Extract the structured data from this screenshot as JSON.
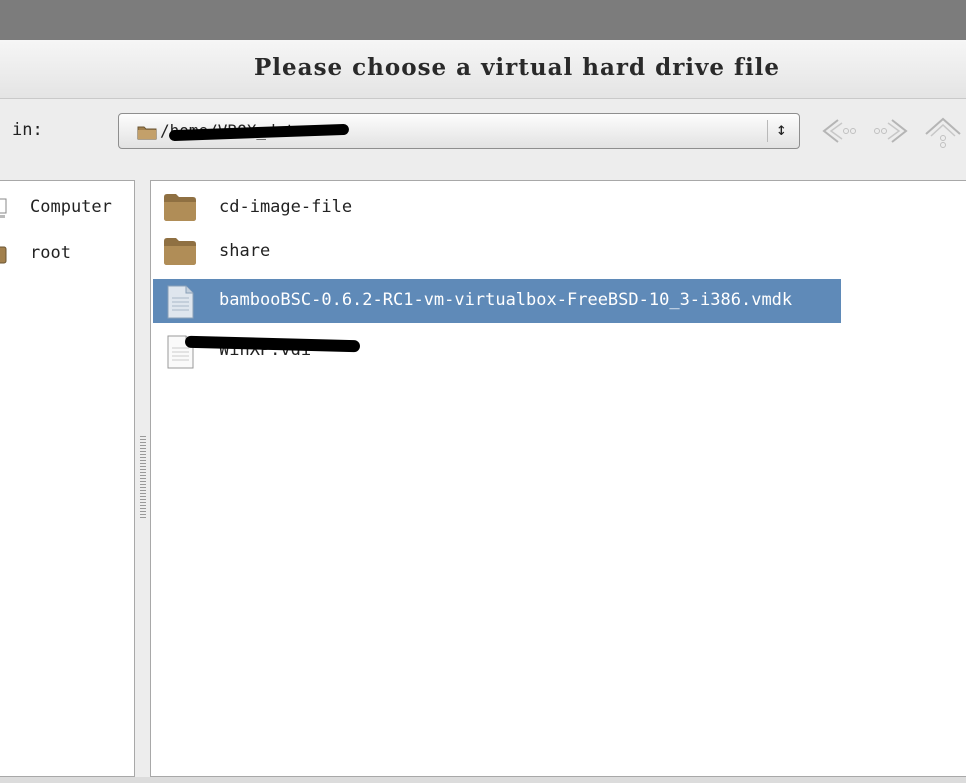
{
  "dialog": {
    "title": "Please choose a virtual hard drive file"
  },
  "toolbar": {
    "look_in_label": "in:",
    "path_value": "/home/VBOX_dat",
    "combo_arrow": "↕"
  },
  "sidebar": {
    "items": [
      {
        "label": "Computer",
        "icon": "computer-icon"
      },
      {
        "label": "root",
        "icon": "home-folder-icon"
      }
    ]
  },
  "files": {
    "items": [
      {
        "name": "cd-image-file",
        "type": "folder"
      },
      {
        "name": "share",
        "type": "folder"
      },
      {
        "name": "bambooBSC-0.6.2-RC1-vm-virtualbox-FreeBSD-10_3-i386.vmdk",
        "type": "file",
        "selected": true
      },
      {
        "name": "WinXP.vdi",
        "type": "file",
        "redacted": true
      }
    ]
  },
  "colors": {
    "selection": "#5f8ab8",
    "folder": "#a2804d"
  }
}
